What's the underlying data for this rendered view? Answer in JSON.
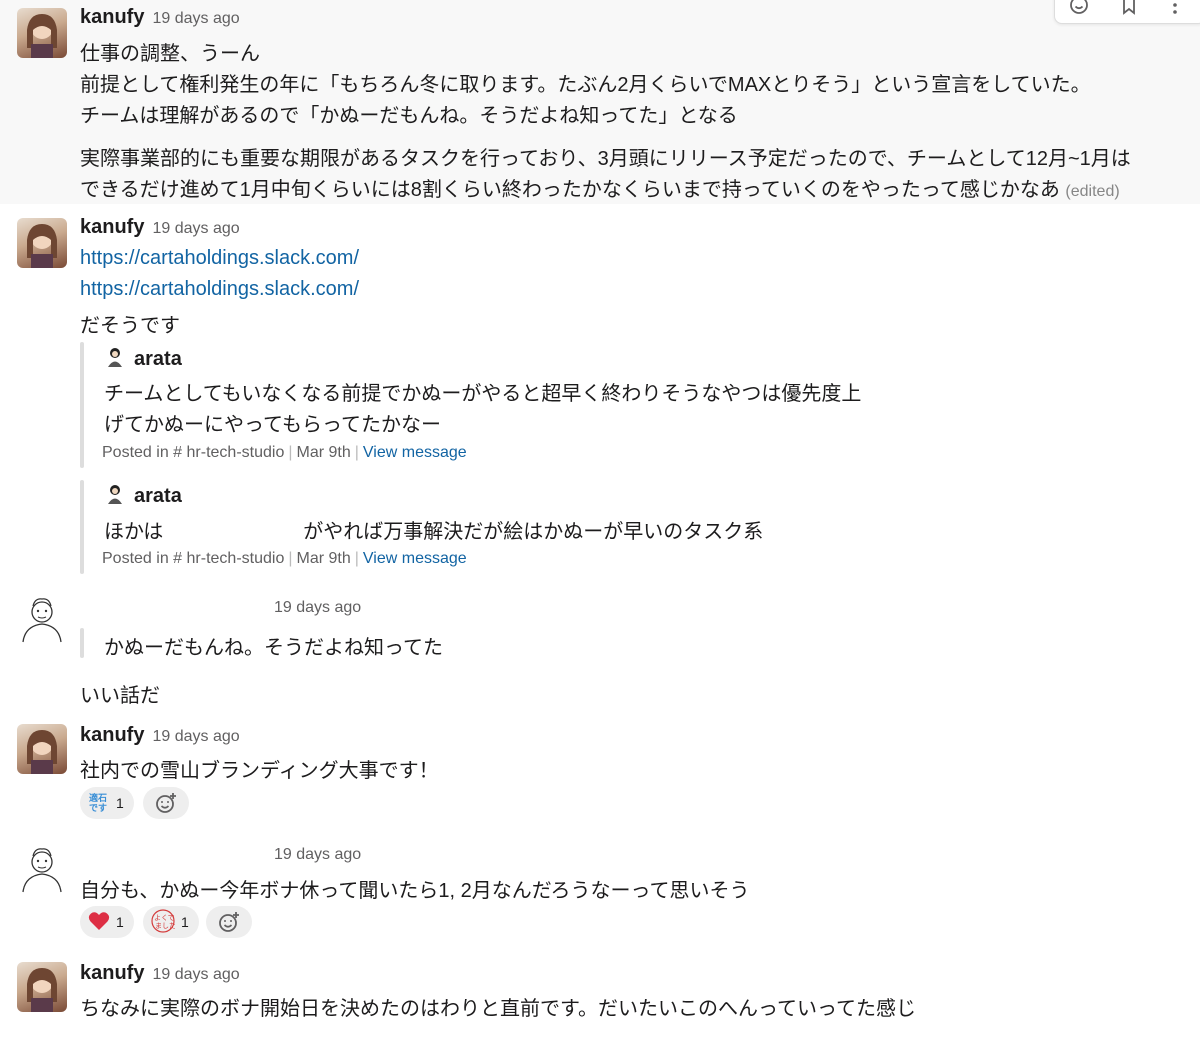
{
  "toolbar": {
    "icons": [
      "add-reaction-icon",
      "bookmark-icon",
      "more-actions-icon"
    ]
  },
  "messages": [
    {
      "author": "kanufy",
      "time": "19 days ago",
      "lines": [
        "仕事の調整、うーん",
        "前提として権利発生の年に「もちろん冬に取ります。たぶん2月くらいでMAXとりそう」という宣言をしていた。",
        "チームは理解があるので「かぬーだもんね。そうだよね知ってた」となる",
        "実際事業部的にも重要な期限があるタスクを行っており、3月頭にリリース予定だったので、チームとして12月~1月は",
        "できるだけ進めて1月中旬くらいには8割くらい終わったかなくらいまで持っていくのをやったって感じかなあ"
      ],
      "edited": "(edited)"
    },
    {
      "author": "kanufy",
      "time": "19 days ago",
      "links": [
        "https://cartaholdings.slack.com/",
        "https://cartaholdings.slack.com/"
      ],
      "text": "だそうです",
      "quotes": [
        {
          "author": "arata",
          "lines": [
            "チームとしてもいなくなる前提でかぬーがやると超早く終わりそうなやつは優先度上",
            "げてかぬーにやってもらってたかなー"
          ],
          "posted_in": "Posted in",
          "channel": "hr-tech-studio",
          "date": "Mar 9th",
          "view": "View message"
        },
        {
          "author": "arata",
          "lines": [
            "ほかは　　　　　　　がやれば万事解決だが絵はかぬーが早いのタスク系"
          ],
          "posted_in": "Posted in",
          "channel": "hr-tech-studio",
          "date": "Mar 9th",
          "view": "View message"
        }
      ]
    },
    {
      "author": "",
      "time": "19 days ago",
      "quote": "かぬーだもんね。そうだよね知ってた",
      "text": "いい話だ"
    },
    {
      "author": "kanufy",
      "time": "19 days ago",
      "text": "社内での雪山ブランディング大事です！",
      "reactions": [
        {
          "icon": "tekizai-desu-emoji",
          "label": "適石です",
          "count": "1"
        }
      ]
    },
    {
      "author": "",
      "time": "19 days ago",
      "text": "自分も、かぬー今年ボナ休って聞いたら1, 2月なんだろうなーって思いそう",
      "reactions": [
        {
          "icon": "heart-emoji",
          "label": "❤️",
          "count": "1"
        },
        {
          "icon": "yoku-dekimashita-emoji",
          "label": "よくできました",
          "count": "1"
        }
      ]
    },
    {
      "author": "kanufy",
      "time": "19 days ago",
      "text": "ちなみに実際のボナ開始日を決めたのはわりと直前です。だいたいこのへんっていってた感じ"
    }
  ],
  "colors": {
    "link": "#1264a3",
    "hover_bg": "#f8f8f8",
    "meta": "#616061",
    "quote_bar": "#dddddd"
  }
}
